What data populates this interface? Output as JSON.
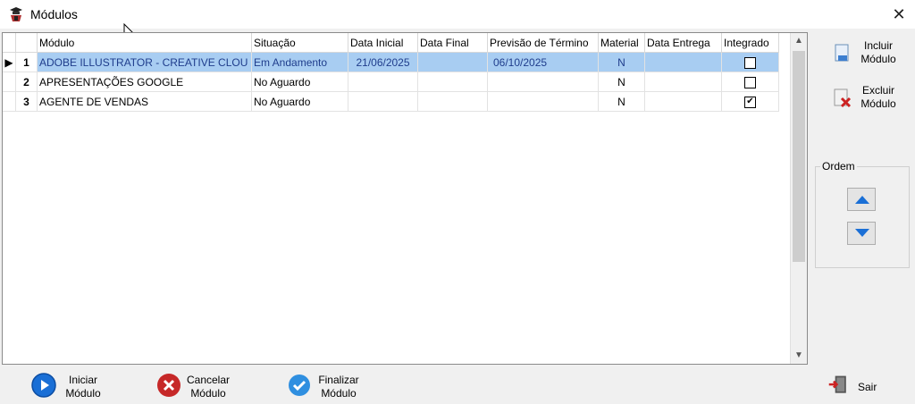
{
  "window": {
    "title": "Módulos",
    "close_icon": "close-icon"
  },
  "grid": {
    "columns": [
      "Módulo",
      "Situação",
      "Data Inicial",
      "Data Final",
      "Previsão de Término",
      "Material",
      "Data Entrega",
      "Integrado"
    ],
    "rows": [
      {
        "num": "1",
        "modulo": "ADOBE ILLUSTRATOR - CREATIVE CLOU",
        "situacao": "Em Andamento",
        "data_inicial": "21/06/2025",
        "data_final": "",
        "previsao": "06/10/2025",
        "material": "N",
        "data_entrega": "",
        "integrado": false,
        "selected": true
      },
      {
        "num": "2",
        "modulo": "APRESENTAÇÕES GOOGLE",
        "situacao": "No Aguardo",
        "data_inicial": "",
        "data_final": "",
        "previsao": "",
        "material": "N",
        "data_entrega": "",
        "integrado": false,
        "selected": false
      },
      {
        "num": "3",
        "modulo": "AGENTE DE VENDAS",
        "situacao": "No Aguardo",
        "data_inicial": "",
        "data_final": "",
        "previsao": "",
        "material": "N",
        "data_entrega": "",
        "integrado": true,
        "selected": false
      }
    ]
  },
  "side": {
    "incluir_line1": "Incluir",
    "incluir_line2": "Módulo",
    "excluir_line1": "Excluir",
    "excluir_line2": "Módulo",
    "ordem_label": "Ordem"
  },
  "bottom": {
    "iniciar_line1": "Iniciar",
    "iniciar_line2": "Módulo",
    "cancelar_line1": "Cancelar",
    "cancelar_line2": "Módulo",
    "finalizar_line1": "Finalizar",
    "finalizar_line2": "Módulo",
    "sair": "Sair"
  },
  "colors": {
    "selection": "#a8cdf2",
    "selection_text": "#1f3d8c",
    "accent_blue": "#1a6fd6",
    "cancel_red": "#c62828"
  }
}
